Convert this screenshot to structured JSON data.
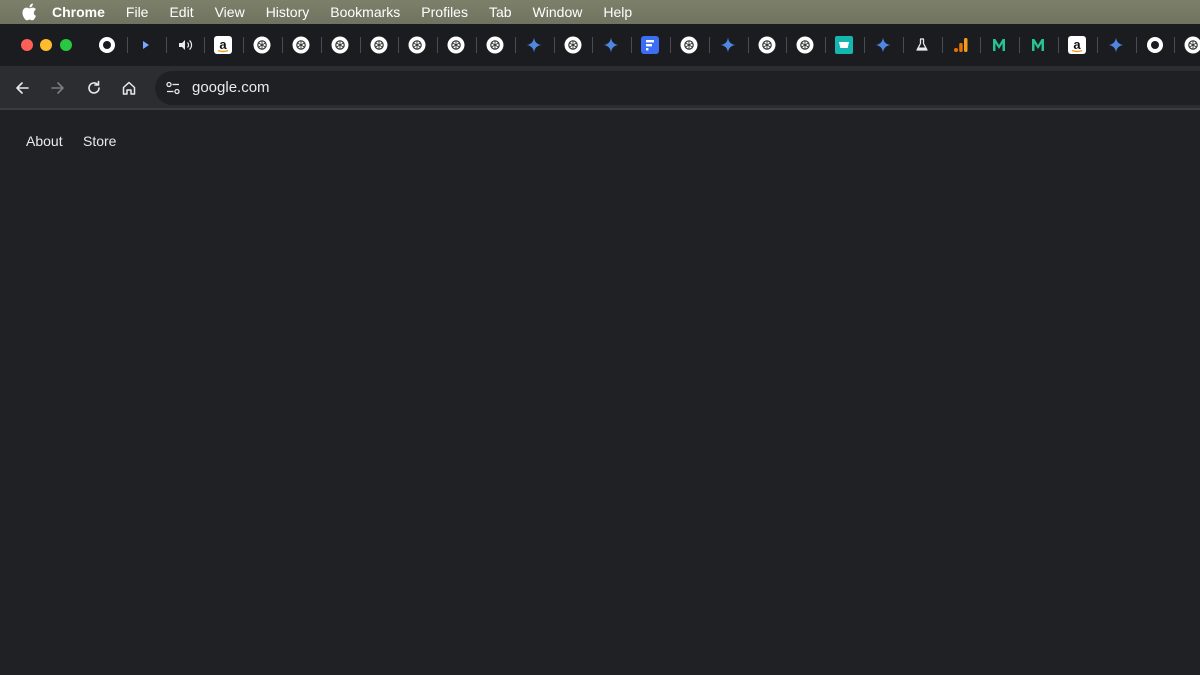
{
  "menubar": {
    "app_name": "Chrome",
    "items": [
      "File",
      "Edit",
      "View",
      "History",
      "Bookmarks",
      "Profiles",
      "Tab",
      "Window",
      "Help"
    ]
  },
  "tabs": [
    {
      "icon": "circle-ring-icon"
    },
    {
      "icon": "media-play-icon"
    },
    {
      "icon": "speaker-icon"
    },
    {
      "icon": "amazon-icon"
    },
    {
      "icon": "openai-icon"
    },
    {
      "icon": "openai-icon"
    },
    {
      "icon": "openai-icon"
    },
    {
      "icon": "openai-icon"
    },
    {
      "icon": "openai-icon"
    },
    {
      "icon": "openai-icon"
    },
    {
      "icon": "openai-icon"
    },
    {
      "icon": "gemini-sparkle-icon"
    },
    {
      "icon": "openai-icon"
    },
    {
      "icon": "gemini-sparkle-icon"
    },
    {
      "icon": "forms-icon"
    },
    {
      "icon": "openai-icon"
    },
    {
      "icon": "gemini-sparkle-icon"
    },
    {
      "icon": "openai-icon"
    },
    {
      "icon": "openai-icon"
    },
    {
      "icon": "shop-icon"
    },
    {
      "icon": "gemini-sparkle-icon"
    },
    {
      "icon": "flask-icon"
    },
    {
      "icon": "analytics-icon"
    },
    {
      "icon": "m-logo-icon"
    },
    {
      "icon": "m-logo-icon"
    },
    {
      "icon": "amazon-icon"
    },
    {
      "icon": "gemini-sparkle-icon"
    },
    {
      "icon": "circle-ring-icon"
    },
    {
      "icon": "openai-icon"
    }
  ],
  "toolbar": {
    "url": "google.com"
  },
  "page": {
    "about_label": "About",
    "store_label": "Store"
  },
  "colors": {
    "menubar": "#757862",
    "tabstrip": "#1b1c1f",
    "toolbar": "#2b2d31",
    "page_bg": "#202124",
    "gemini_blue": "#4f86e0",
    "m_green": "#27c28f",
    "analytics_orange": "#f29b1d"
  }
}
